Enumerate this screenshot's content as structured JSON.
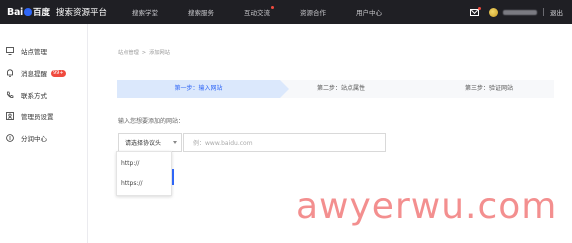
{
  "brand": {
    "logo_text": "Bai",
    "logo_text_cn": "百度",
    "site_name": "搜索资源平台"
  },
  "nav": [
    {
      "label": "搜索学堂",
      "dot": false
    },
    {
      "label": "搜索服务",
      "dot": false
    },
    {
      "label": "互动交流",
      "dot": true
    },
    {
      "label": "资源合作",
      "dot": false
    },
    {
      "label": "用户中心",
      "dot": false
    }
  ],
  "user": {
    "logout_label": "退出"
  },
  "sidebar": {
    "items": [
      {
        "label": "站点管理",
        "icon": "monitor-icon"
      },
      {
        "label": "消息提醒",
        "icon": "bell-icon",
        "badge": "99+"
      },
      {
        "label": "联系方式",
        "icon": "phone-icon"
      },
      {
        "label": "管理员设置",
        "icon": "admin-icon"
      },
      {
        "label": "分润中心",
        "icon": "coin-icon"
      }
    ]
  },
  "breadcrumb": {
    "root": "站点管理",
    "separator": ">",
    "current": "添加网站"
  },
  "steps": [
    {
      "label": "第一步：输入网站",
      "active": true
    },
    {
      "label": "第二步：站点属性",
      "active": false
    },
    {
      "label": "第三步：验证网站",
      "active": false
    }
  ],
  "form": {
    "prompt": "输入您想要添加的网站：",
    "protocol_select": {
      "label": "请选择协议头",
      "options": [
        "http://",
        "https://"
      ]
    },
    "url_placeholder": "例：www.baidu.com"
  },
  "watermark": "awyerwu.com",
  "colors": {
    "accent": "#2f66f6",
    "topbar": "#1f1f24",
    "badge": "#f04a3e",
    "step_active_bg": "#dbe8fc"
  }
}
